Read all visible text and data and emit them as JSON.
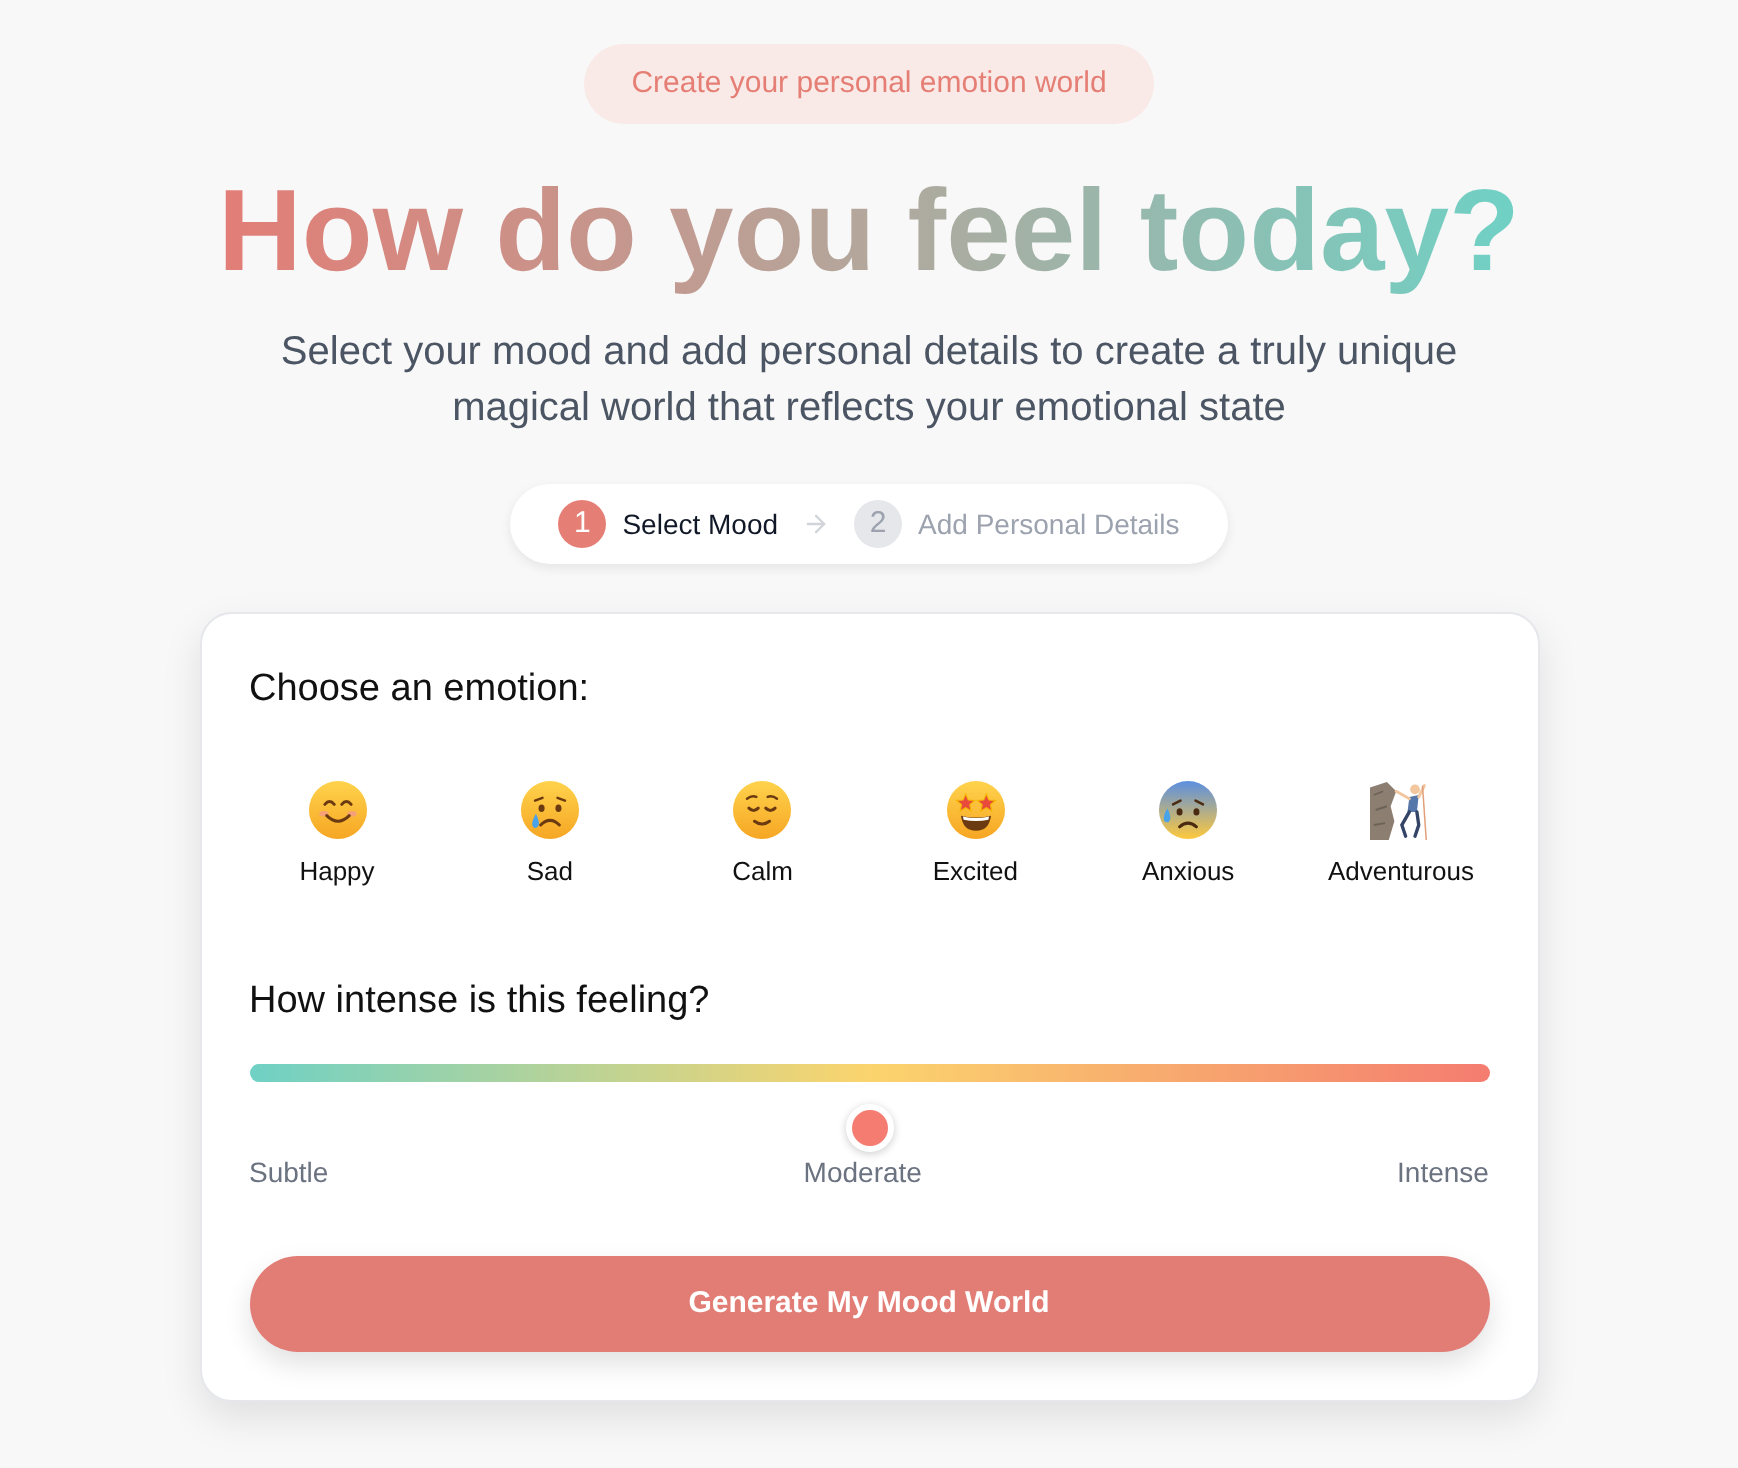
{
  "badge": "Create your personal emotion world",
  "title": "How do you feel today?",
  "subtitle": "Select your mood and add personal details to create a truly unique magical world that reflects your emotional state",
  "steps": [
    {
      "number": "1",
      "label": "Select Mood",
      "selected": true
    },
    {
      "number": "2",
      "label": "Add Personal Details",
      "selected": false
    }
  ],
  "card": {
    "emotion_heading": "Choose an emotion:",
    "emotions": [
      {
        "label": "Happy",
        "selected": false
      },
      {
        "label": "Sad",
        "selected": false
      },
      {
        "label": "Calm",
        "selected": false
      },
      {
        "label": "Excited",
        "selected": false
      },
      {
        "label": "Anxious",
        "selected": false
      },
      {
        "label": "Adventurous",
        "selected": false
      }
    ],
    "intensity_heading": "How intense is this feeling?",
    "intensity": {
      "level": 0.5,
      "labels": [
        "Subtle",
        "Moderate",
        "Intense"
      ]
    },
    "button": "Generate My Mood World"
  }
}
